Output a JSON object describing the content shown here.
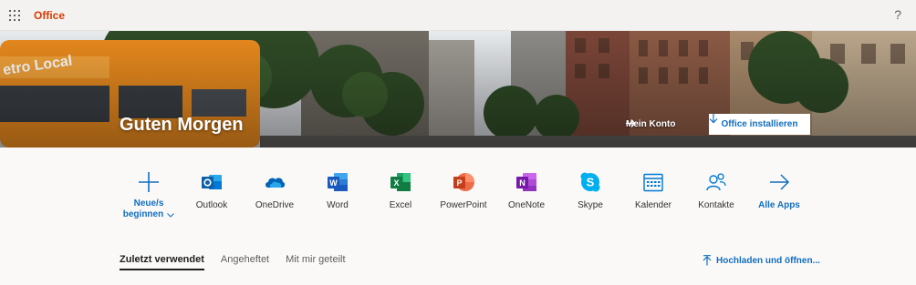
{
  "topbar": {
    "app_name": "Office",
    "help_label": "?"
  },
  "hero": {
    "greeting": "Guten Morgen",
    "account_link": "Mein Konto",
    "install_button": "Office installieren"
  },
  "apps": [
    {
      "label": "Neue/s beginnen",
      "icon": "plus-icon"
    },
    {
      "label": "Outlook",
      "icon": "outlook-icon",
      "color": "#0078d4"
    },
    {
      "label": "OneDrive",
      "icon": "onedrive-icon",
      "color": "#0364b8"
    },
    {
      "label": "Word",
      "icon": "word-icon",
      "color": "#185abd"
    },
    {
      "label": "Excel",
      "icon": "excel-icon",
      "color": "#107c41"
    },
    {
      "label": "PowerPoint",
      "icon": "powerpoint-icon",
      "color": "#c43e1c"
    },
    {
      "label": "OneNote",
      "icon": "onenote-icon",
      "color": "#7719aa"
    },
    {
      "label": "Skype",
      "icon": "skype-icon",
      "color": "#00aff0"
    },
    {
      "label": "Kalender",
      "icon": "calendar-icon",
      "color": "#0078d4"
    },
    {
      "label": "Kontakte",
      "icon": "contacts-icon",
      "color": "#0078d4"
    },
    {
      "label": "Alle Apps",
      "icon": "arrow-right-icon",
      "color": "#106ebe"
    }
  ],
  "new_doc": {
    "line1": "Neue/s",
    "line2": "beginnen"
  },
  "tabs": [
    {
      "label": "Zuletzt verwendet",
      "active": true
    },
    {
      "label": "Angeheftet",
      "active": false
    },
    {
      "label": "Mit mir geteilt",
      "active": false
    }
  ],
  "upload_label": "Hochladen und öffnen...",
  "colors": {
    "brand": "#d83b01",
    "accent": "#106ebe",
    "background": "#faf9f8"
  }
}
